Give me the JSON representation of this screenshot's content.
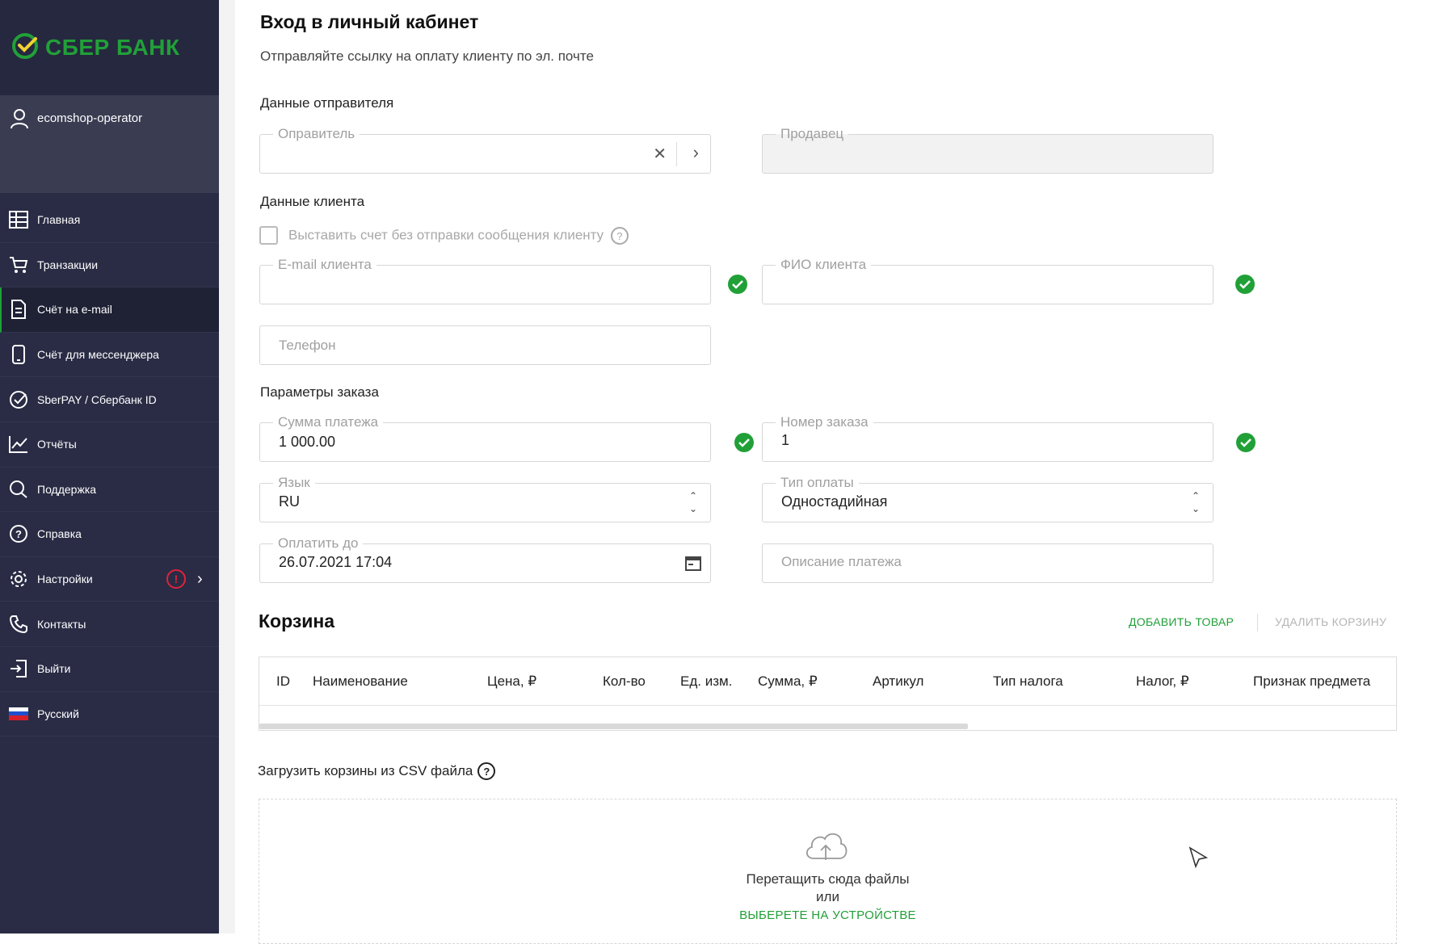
{
  "brand": {
    "name": "СБЕР БАНК",
    "color": "#21a038"
  },
  "user": {
    "name": "ecomshop-operator"
  },
  "nav": [
    {
      "label": "Главная",
      "icon": "table-icon"
    },
    {
      "label": "Транзакции",
      "icon": "cart-icon"
    },
    {
      "label": "Счёт на e-mail",
      "icon": "document-icon",
      "active": true
    },
    {
      "label": "Счёт для мессенджера",
      "icon": "phone-icon"
    },
    {
      "label": "SberPAY / Сбербанк ID",
      "icon": "sber-check-icon"
    },
    {
      "label": "Отчёты",
      "icon": "chart-icon"
    },
    {
      "label": "Поддержка",
      "icon": "chat-icon"
    },
    {
      "label": "Справка",
      "icon": "help-icon"
    },
    {
      "label": "Настройки",
      "icon": "gear-icon",
      "warning": "!"
    },
    {
      "label": "Контакты",
      "icon": "phone-handset-icon"
    },
    {
      "label": "Выйти",
      "icon": "logout-icon"
    },
    {
      "label": "Русский",
      "icon": "russian-flag-icon"
    }
  ],
  "page": {
    "title": "Вход в личный кабинет",
    "subtitle": "Отправляйте ссылку на оплату клиенту по эл. почте"
  },
  "sender": {
    "section": "Данные отправителя",
    "sender_label": "Оправитель",
    "seller_label": "Продавец"
  },
  "client": {
    "section": "Данные клиента",
    "no_message_label": "Выставить счет без отправки сообщения клиенту",
    "email_label": "E-mail клиента",
    "name_label": "ФИО клиента",
    "phone_placeholder": "Телефон"
  },
  "order": {
    "section": "Параметры заказа",
    "amount_label": "Сумма платежа",
    "amount_value": "1 000.00",
    "order_no_label": "Номер заказа",
    "order_no_value": "1",
    "lang_label": "Язык",
    "lang_value": "RU",
    "pay_type_label": "Тип оплаты",
    "pay_type_value": "Одностадийная",
    "pay_until_label": "Оплатить до",
    "pay_until_value": "26.07.2021 17:04",
    "description_placeholder": "Описание платежа"
  },
  "cart": {
    "title": "Корзина",
    "add_label": "ДОБАВИТЬ ТОВАР",
    "delete_label": "УДАЛИТЬ КОРЗИНУ",
    "columns": [
      "ID",
      "Наименование",
      "Цена, ₽",
      "Кол-во",
      "Ед. изм.",
      "Сумма, ₽",
      "Артикул",
      "Тип налога",
      "Налог, ₽",
      "Признак предмета"
    ]
  },
  "csv": {
    "title": "Загрузить корзины из CSV файла",
    "drop_text": "Перетащить сюда файлы",
    "or": "или",
    "choose": "ВЫБЕРЕТЕ НА УСТРОЙСТВЕ"
  }
}
